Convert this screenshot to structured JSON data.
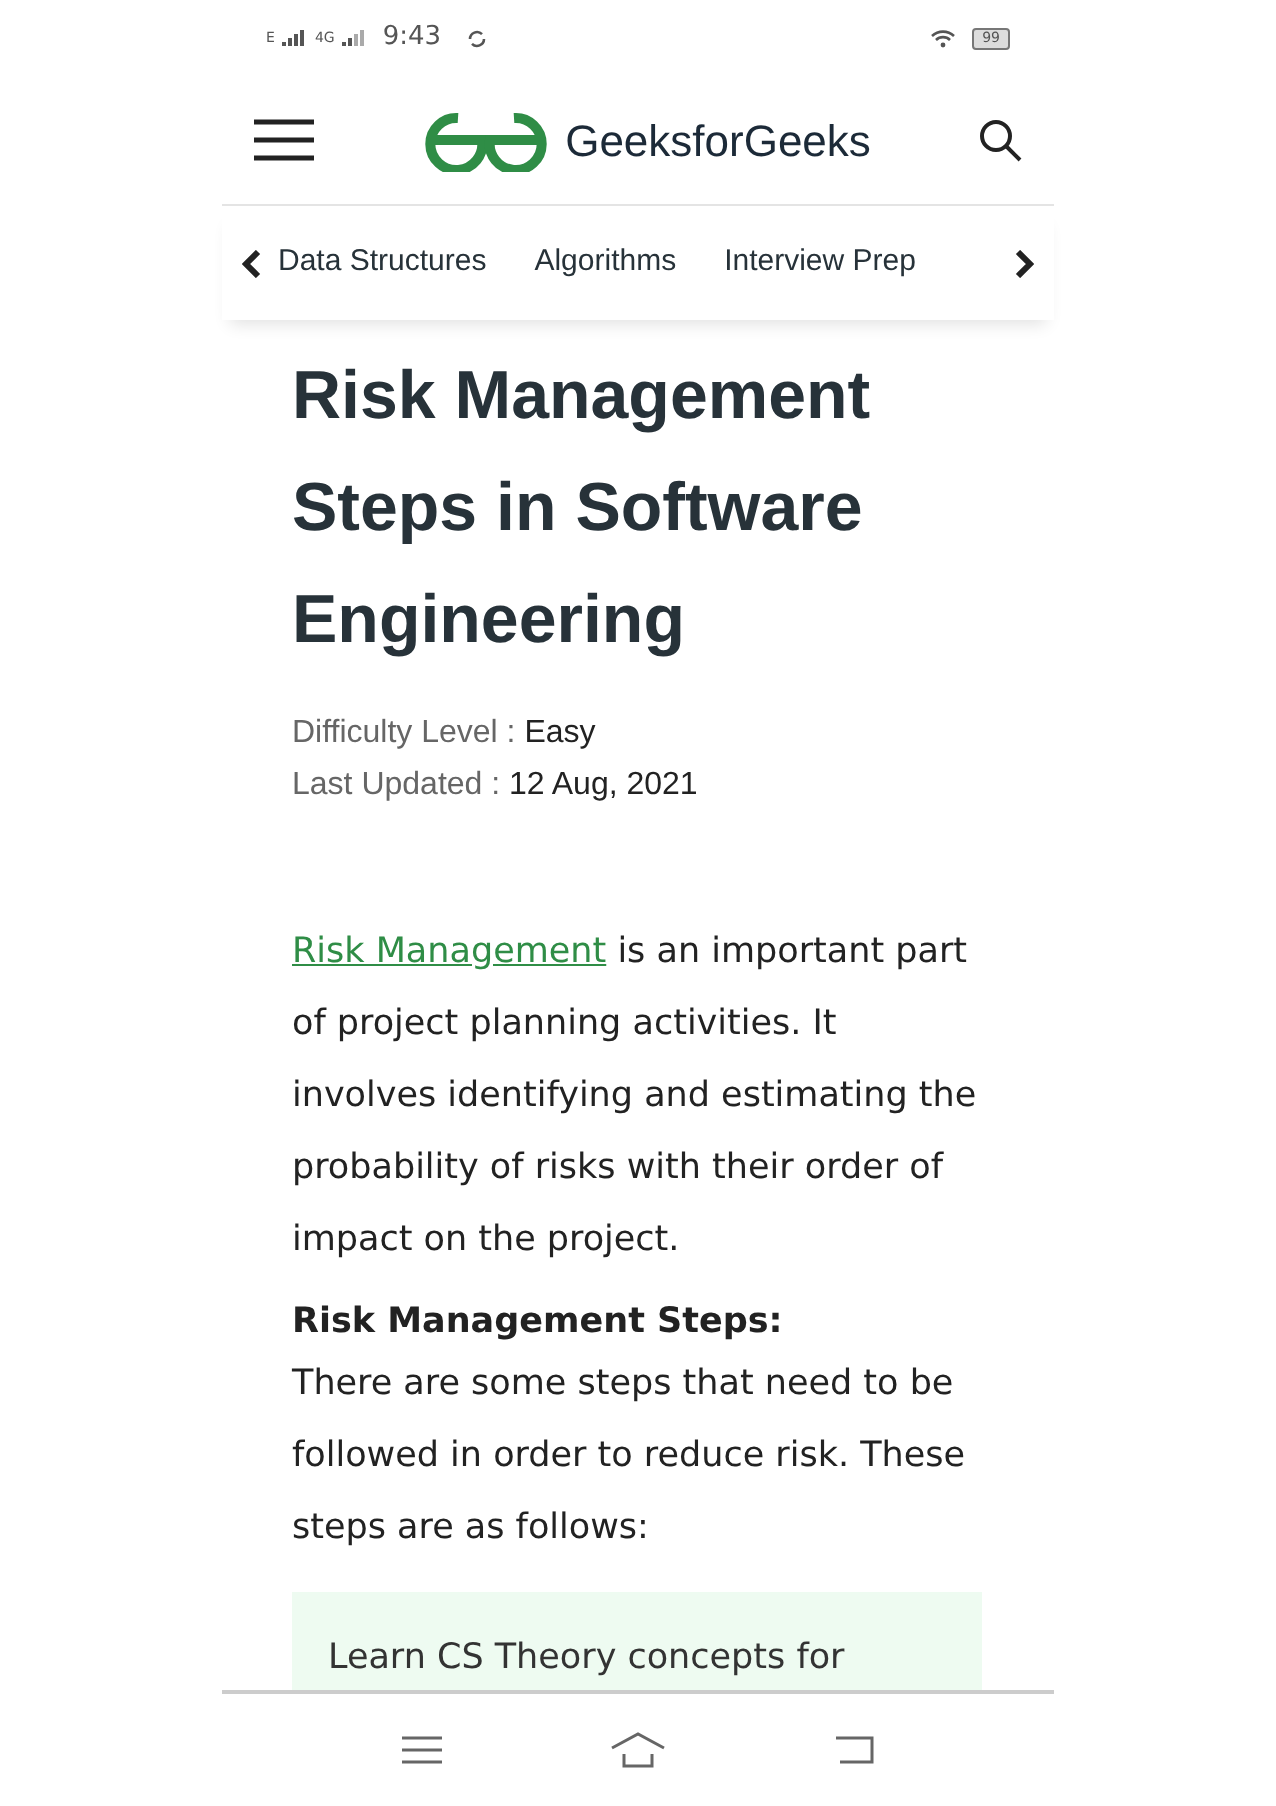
{
  "status_bar": {
    "network_1": "E",
    "network_2": "4G",
    "time": "9:43",
    "battery": "99"
  },
  "header": {
    "logo_text": "GeeksforGeeks"
  },
  "category_nav": {
    "items": [
      {
        "label": "Data Structures"
      },
      {
        "label": "Algorithms"
      },
      {
        "label": "Interview Prep"
      }
    ]
  },
  "article": {
    "title": "Risk Management Steps in Software Engineering",
    "meta": [
      {
        "label": "Difficulty Level : ",
        "value": "Easy"
      },
      {
        "label": "Last Updated : ",
        "value": "12 Aug, 2021"
      }
    ],
    "intro_link": "Risk Management",
    "intro_rest": " is an important part of project planning activities. It involves identifying and estimating the probability of risks with their order of impact on the project.",
    "subheading": "Risk Management Steps:",
    "paragraph": "There are some steps that need to be followed in order to reduce risk. These steps are as follows:",
    "promo": "Learn CS Theory concepts for"
  }
}
